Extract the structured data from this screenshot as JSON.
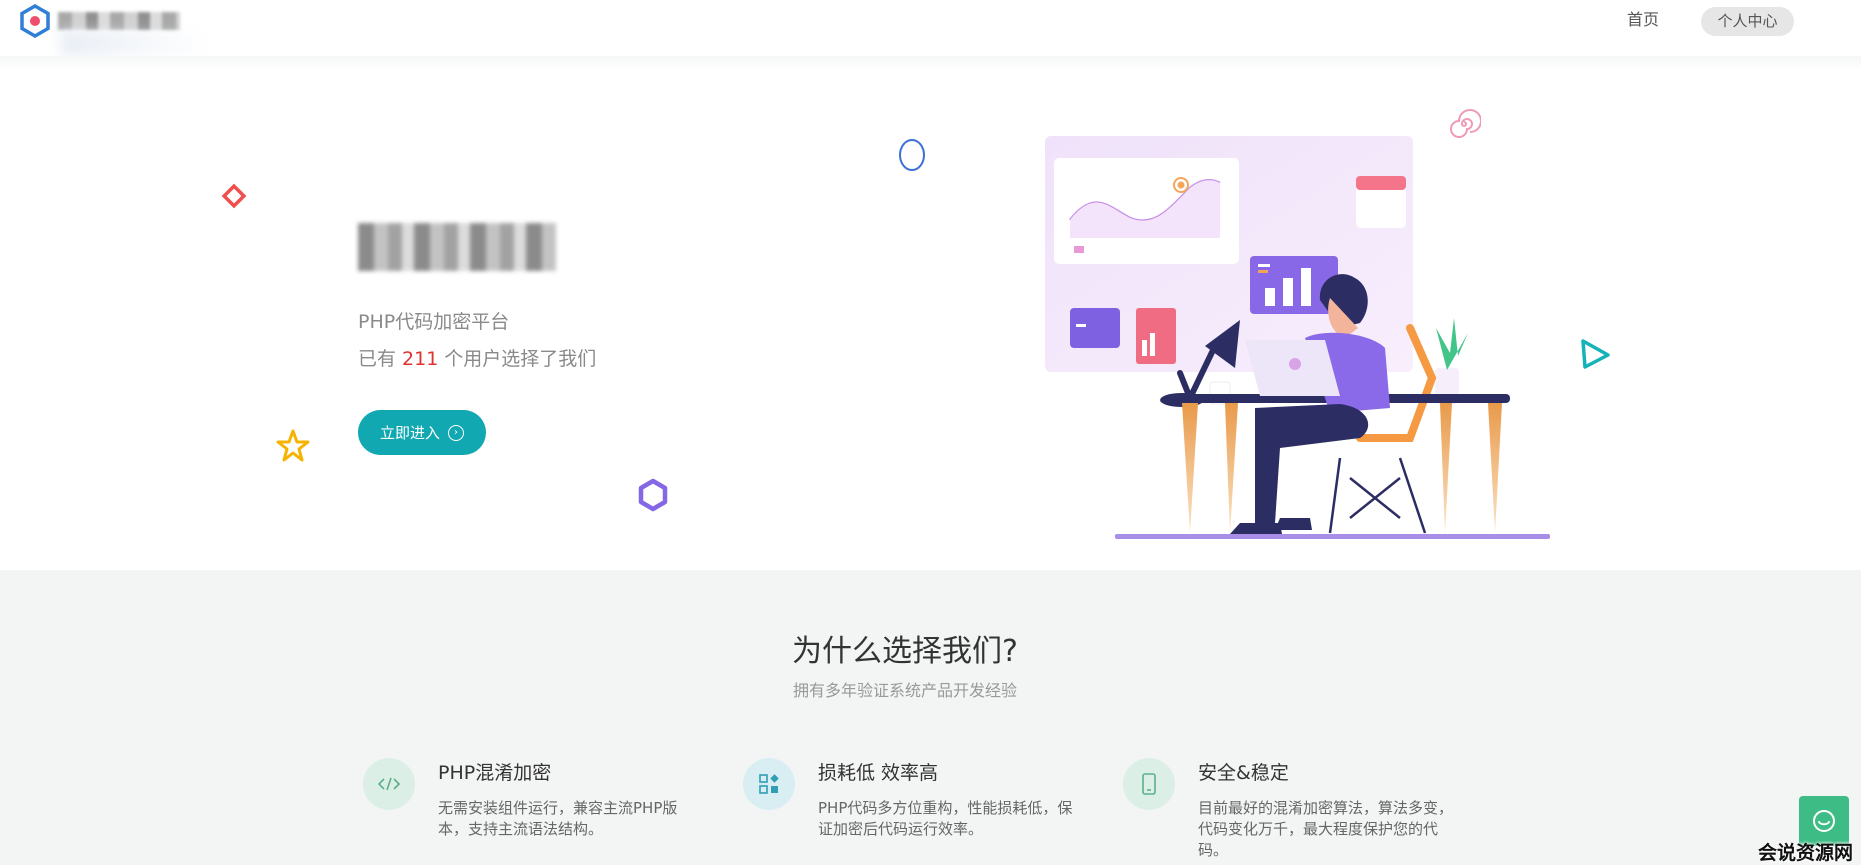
{
  "header": {
    "nav_home": "首页",
    "nav_user_center": "个人中心"
  },
  "hero": {
    "subtitle": "PHP代码加密平台",
    "users_prefix": "已有",
    "users_count": "211",
    "users_suffix": "个用户选择了我们",
    "enter_button": "立即进入"
  },
  "why": {
    "title": "为什么选择我们?",
    "subtitle": "拥有多年验证系统产品开发经验"
  },
  "features": [
    {
      "icon": "code-icon",
      "title": "PHP混淆加密",
      "description": "无需安装组件运行，兼容主流PHP版本，支持主流语法结构。"
    },
    {
      "icon": "grid-blocks-icon",
      "title": "损耗低 效率高",
      "description": "PHP代码多方位重构，性能损耗低，保证加密后代码运行效率。"
    },
    {
      "icon": "phone-icon",
      "title": "安全&稳定",
      "description": "目前最好的混淆加密算法，算法多变，代码变化万千，最大程度保护您的代码。"
    }
  ],
  "watermark": "会说资源网",
  "colors": {
    "accent": "#12a8b1",
    "count_red": "#e0312f",
    "chat_green": "#3ebc85",
    "feature_bg": "#f3f4f4"
  }
}
